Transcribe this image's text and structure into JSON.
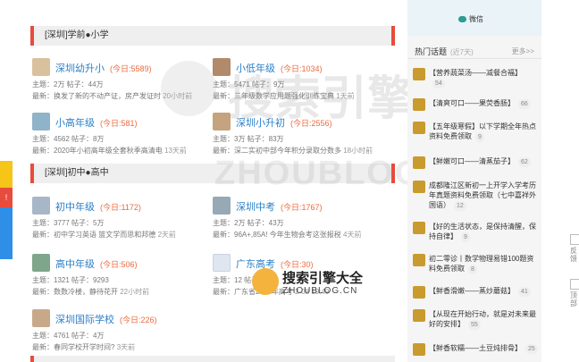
{
  "left_strip": {
    "label": "!"
  },
  "sections": [
    {
      "title": "[深圳]学前●小学",
      "forums": [
        {
          "name": "深圳幼升小",
          "today": "(今日:5589)",
          "stats": "主题：2万    帖子：44万",
          "latest_prefix": "最新：",
          "latest": "换发了新的不动产证，房产发证时",
          "time": "20小时前"
        },
        {
          "name": "小低年级",
          "today": "(今日:1034)",
          "stats": "主题：5471    帖子：9万",
          "latest_prefix": "最新：",
          "latest": "三年级数学应用题强化训练宝典",
          "time": "1天前"
        },
        {
          "name": "小高年级",
          "today": "(今日:581)",
          "stats": "主题：4562    帖子：8万",
          "latest_prefix": "最新：",
          "latest": "2020年小初高年级全套秋季高清电",
          "time": "13天前"
        },
        {
          "name": "深圳小升初",
          "today": "(今日:2556)",
          "stats": "主题：3万    帖子：83万",
          "latest_prefix": "最新：",
          "latest": "深二实初中部今年积分录取分数多",
          "time": "18小时前"
        }
      ]
    },
    {
      "title": "[深圳]初中●高中",
      "forums": [
        {
          "name": "初中年级",
          "today": "(今日:1172)",
          "stats": "主题：3777    帖子：5万",
          "latest_prefix": "最新：",
          "latest": "初中学习英语 篮文学而思和邦德",
          "time": "2天前"
        },
        {
          "name": "深圳中考",
          "today": "(今日:1767)",
          "stats": "主题：2万    帖子：43万",
          "latest_prefix": "最新：",
          "latest": "96A+,85A!  今年生物会考这张报税",
          "time": "4天前"
        },
        {
          "name": "高中年级",
          "today": "(今日:506)",
          "stats": "主题：1321    帖子：9293",
          "latest_prefix": "最新：",
          "latest": "数数冷楼，静待花开",
          "time": "22小时前"
        },
        {
          "name": "广东高考",
          "today": "(今日:30)",
          "stats": "主题：12    帖子：",
          "latest_prefix": "最新：",
          "latest": "广东省2019年高考",
          "time": "2-08 19:49"
        },
        {
          "name": "深圳国际学校",
          "today": "(今日:226)",
          "stats": "主题：4761    帖子：4万",
          "latest_prefix": "最新：",
          "latest": "春同学校开学时间?",
          "time": "3天前"
        }
      ]
    }
  ],
  "sidebar": {
    "weixin_label": "微信",
    "hot_title": "热门话题",
    "hot_sub": "(近7天)",
    "more": "更多>>",
    "topics": [
      {
        "text": "【营养蔬菜汤——减餐合福】",
        "count": "54"
      },
      {
        "text": "【清爽可口——果荧香肠】",
        "count": "66"
      },
      {
        "text": "【五年级寒假】以下学期全年热点资料免费领取",
        "count": "9"
      },
      {
        "text": "【鲜嫩可口——清蒸茄子】",
        "count": "62"
      },
      {
        "text": "成都隆江区新初一上开学入学考历年真题资料免费领取（七中嘉祥外国语）",
        "count": "12"
      },
      {
        "text": "【好的生活状态，是保持清醒，保持自律】",
        "count": "9"
      },
      {
        "text": "初二零诊丨数学物理易错100题资料免费领取",
        "count": "8"
      },
      {
        "text": "【鲜香滑嫩——蒸炒蘑菇】",
        "count": "41"
      },
      {
        "text": "【从现在开始行动，就是对未来最好的安排】",
        "count": "55"
      },
      {
        "text": "【鲜香软糯——土豆炖排骨】",
        "count": "25"
      }
    ]
  },
  "right_strip": {
    "item1": "反馈",
    "item2": "顶部"
  },
  "watermark": {
    "cn": "搜索引擎大全",
    "en": "ZHOUBLOG.CN"
  }
}
